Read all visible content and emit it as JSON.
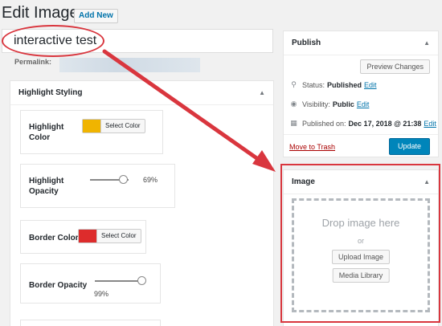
{
  "header": {
    "title": "Edit Image",
    "add_new": "Add New"
  },
  "post": {
    "title_value": "interactive test",
    "permalink_label": "Permalink:"
  },
  "highlight_styling": {
    "title": "Highlight Styling",
    "highlight_color_label": "Highlight Color",
    "highlight_color": "#f0b400",
    "select_color": "Select Color",
    "highlight_opacity_label": "Highlight Opacity",
    "highlight_opacity_value": "69%",
    "highlight_opacity_fraction": 0.69,
    "border_color_label": "Border Color",
    "border_color": "#dd2c2c",
    "border_opacity_label": "Border Opacity",
    "border_opacity_value": "99%",
    "border_opacity_fraction": 0.99
  },
  "publish": {
    "title": "Publish",
    "preview": "Preview Changes",
    "status_label": "Status:",
    "status_value": "Published",
    "visibility_label": "Visibility:",
    "visibility_value": "Public",
    "published_label": "Published on:",
    "published_value": "Dec 17, 2018 @ 21:38",
    "edit": "Edit",
    "trash": "Move to Trash",
    "update": "Update"
  },
  "image": {
    "title": "Image",
    "drop_text": "Drop image here",
    "or": "or",
    "upload": "Upload Image",
    "media_library": "Media Library"
  },
  "colors": {
    "accent": "#0085ba",
    "annotation": "#d9363e",
    "link": "#0073aa"
  }
}
